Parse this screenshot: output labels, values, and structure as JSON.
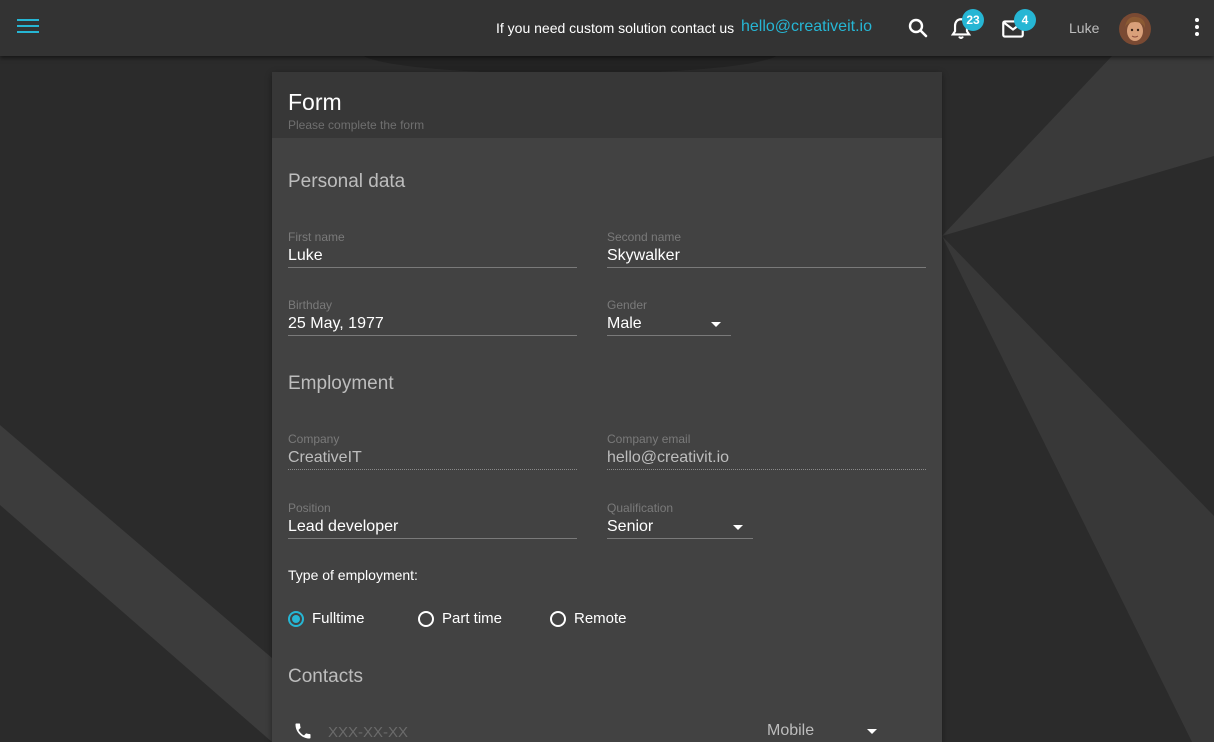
{
  "topbar": {
    "contact_text": "If you need custom solution contact us",
    "contact_email": "hello@creativeit.io",
    "notifications_count": "23",
    "messages_count": "4",
    "user_name": "Luke"
  },
  "icons": {
    "menu": "hamburger-icon",
    "search": "search-icon",
    "notifications": "bell-icon",
    "messages": "mail-icon",
    "more": "more-vertical-icon",
    "phone": "phone-icon"
  },
  "colors": {
    "accent": "#26b6d4",
    "card": "#424242",
    "background": "#2b2b2b",
    "topbar": "#333333"
  },
  "form": {
    "title": "Form",
    "subtitle": "Please complete the form",
    "personal": {
      "title": "Personal data",
      "first_name_label": "First name",
      "first_name": "Luke",
      "second_name_label": "Second name",
      "second_name": "Skywalker",
      "birthday_label": "Birthday",
      "birthday": "25 May, 1977",
      "gender_label": "Gender",
      "gender": "Male"
    },
    "employment": {
      "title": "Employment",
      "company_label": "Company",
      "company": "CreativeIT",
      "company_email_label": "Company email",
      "company_email": "hello@creativit.io",
      "position_label": "Position",
      "position": "Lead developer",
      "qualification_label": "Qualification",
      "qualification": "Senior",
      "type_label": "Type of employment:",
      "types": [
        {
          "label": "Fulltime",
          "checked": true
        },
        {
          "label": "Part time",
          "checked": false
        },
        {
          "label": "Remote",
          "checked": false
        }
      ]
    },
    "contacts": {
      "title": "Contacts",
      "phone_placeholder": "XXX-XX-XX",
      "phone_type": "Mobile"
    }
  }
}
